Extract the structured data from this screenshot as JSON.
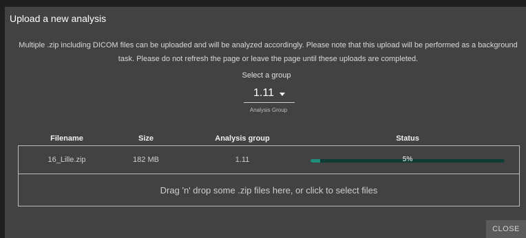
{
  "dialog": {
    "title": "Upload a new analysis",
    "description": "Multiple .zip including DICOM files can be uploaded and will be analyzed accordingly. Please note that this upload will be performed as a background task. Please do not refresh the page or leave the page until these uploads are completed."
  },
  "group_select": {
    "label": "Select a group",
    "value": "1.11",
    "helper": "Analysis Group"
  },
  "table": {
    "headers": [
      "Filename",
      "Size",
      "Analysis group",
      "Status"
    ],
    "rows": [
      {
        "filename": "16_Lille.zip",
        "size": "182 MB",
        "group": "1.11",
        "status_text": "5%",
        "progress": 0.05
      }
    ],
    "dropzone": "Drag 'n' drop some .zip files here, or click to select files"
  },
  "actions": {
    "close": "CLOSE"
  },
  "colors": {
    "dialog_bg": "#424242",
    "progress_track": "#0f3c34",
    "progress_fill": "#1f8f7a"
  }
}
